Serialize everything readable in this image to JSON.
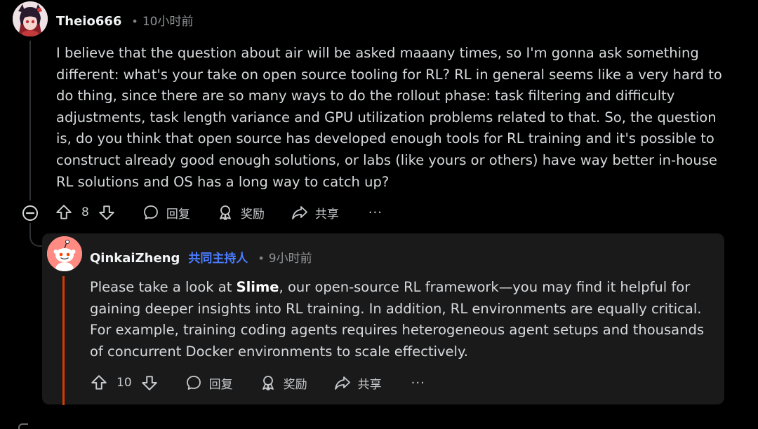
{
  "top_comment": {
    "username": "Theio666",
    "time": "10小时前",
    "body": "I believe that the question about air will be asked maaany times, so I'm gonna ask something different: what's your take on open source tooling for RL? RL in general seems like a very hard to do thing, since there are so many ways to do the rollout phase: task filtering and difficulty adjustments, task length variance and GPU utilization problems related to that. So, the question is, do you think that open source has developed enough tools for RL training and it's possible to construct already good enough solutions, or labs (like yours or others) have way better in-house RL solutions and OS has a long way to catch up?",
    "votes": "8",
    "reply_label": "回复",
    "award_label": "奖励",
    "share_label": "共享",
    "more_label": "···"
  },
  "reply_comment": {
    "username": "QinkaiZheng",
    "flair": "共同主持人",
    "time": "9小时前",
    "body_prefix": "Please take a look at ",
    "body_bold": "Slime",
    "body_suffix": ", our open-source RL framework—you may find it helpful for gaining deeper insights into RL training. In addition, RL environments are equally critical. For example, training coding agents requires heterogeneous agent setups and thousands of concurrent Docker environments to scale effectively.",
    "votes": "10",
    "reply_label": "回复",
    "award_label": "奖励",
    "share_label": "共享",
    "more_label": "···"
  },
  "colors": {
    "background": "#000000",
    "card": "#1a1a1b",
    "accent_bar": "#d93a00",
    "flair": "#4a7dff",
    "reply_avatar": "#ff8b83"
  },
  "icons": [
    "upvote-icon",
    "downvote-icon",
    "comment-icon",
    "award-icon",
    "share-icon",
    "collapse-icon",
    "snoo-avatar-icon"
  ]
}
